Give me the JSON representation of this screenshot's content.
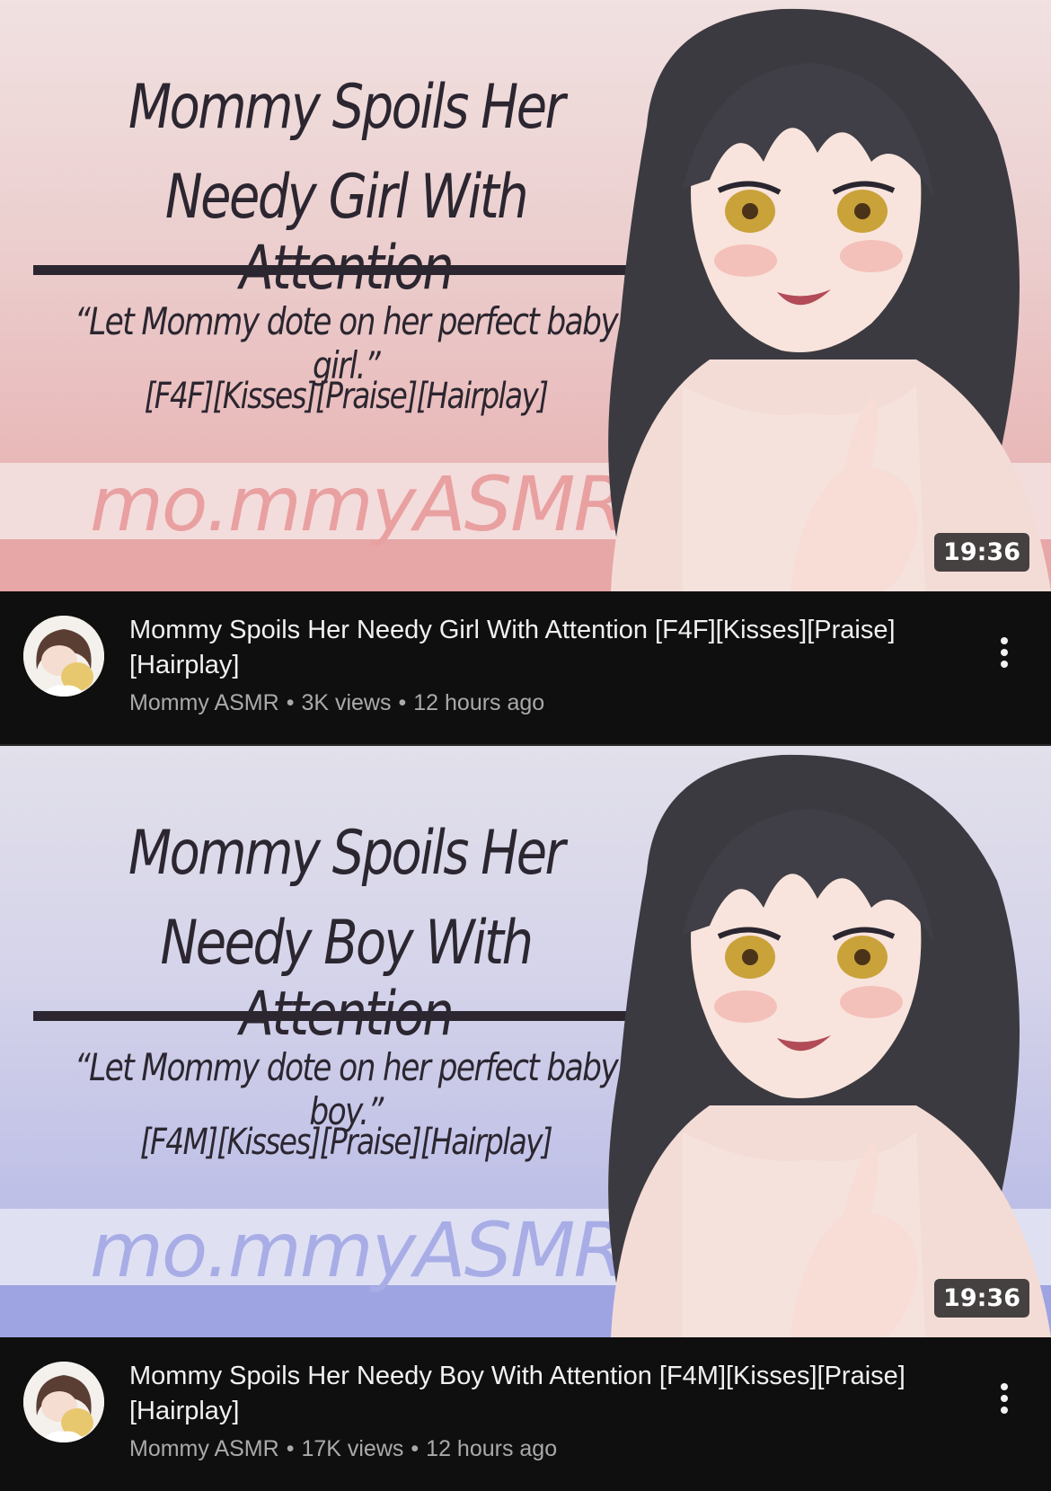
{
  "videos": [
    {
      "thumbnail": {
        "title_line_1": "Mommy Spoils Her",
        "title_line_2": "Needy Girl With Attention",
        "quote": "“Let Mommy dote on her perfect baby girl.”",
        "tags": "[F4F][Kisses][Praise][Hairplay]",
        "brand": "mo.mmyASMR"
      },
      "duration": "19:36",
      "title": "Mommy Spoils Her Needy Girl With Attention [F4F][Kisses][Praise][Hairplay]",
      "channel": "Mommy ASMR",
      "views": "3K views",
      "age": "12 hours ago",
      "separator": "•",
      "theme": {
        "bg_top": "#f1e1e1",
        "bg_bottom": "#e29e9e"
      },
      "more_icon": "more-vertical-icon"
    },
    {
      "thumbnail": {
        "title_line_1": "Mommy Spoils Her",
        "title_line_2": "Needy Boy With Attention",
        "quote": "“Let Mommy dote on her perfect baby boy.”",
        "tags": "[F4M][Kisses][Praise][Hairplay]",
        "brand": "mo.mmyASMR"
      },
      "duration": "19:36",
      "title": "Mommy Spoils Her Needy Boy With Attention [F4M][Kisses][Praise][Hairplay]",
      "channel": "Mommy ASMR",
      "views": "17K views",
      "age": "12 hours ago",
      "separator": "•",
      "theme": {
        "bg_top": "#e2e0ea",
        "bg_bottom": "#a4a8e2"
      },
      "more_icon": "more-vertical-icon"
    }
  ],
  "colors": {
    "feed_background": "#0f0f0f",
    "title_text": "#f1f1f1",
    "meta_text": "#aaaaaa"
  }
}
